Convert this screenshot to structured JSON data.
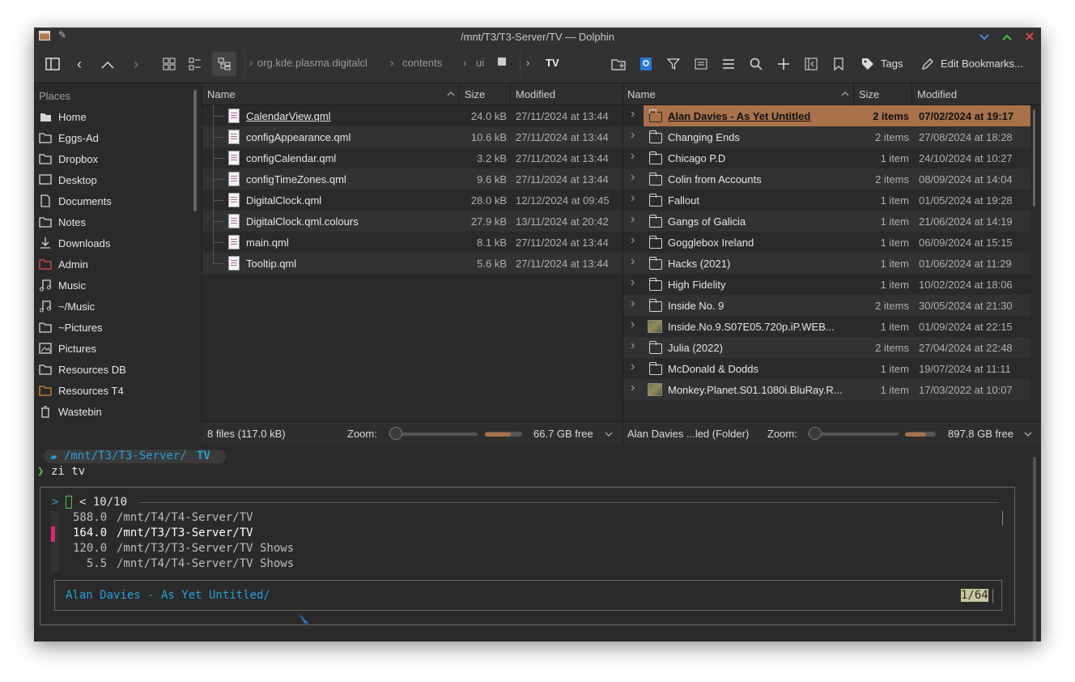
{
  "window": {
    "title": "/mnt/T3/T3-Server/TV — Dolphin",
    "min_icon": "chevron-down-icon",
    "max_icon": "chevron-up-icon",
    "close_icon": "close-icon"
  },
  "colors": {
    "accent": "#a9714a",
    "background": "#2a2a2a",
    "prompt_path": "#2a9fd6",
    "prompt_arrow": "#4ec94e",
    "close": "#e04848",
    "maximize": "#49c149",
    "minimize": "#4a8ad4",
    "marker": "#e0247c"
  },
  "toolbar": {
    "breadcrumbs": [
      "org.kde.plasma.digitalcl",
      "contents",
      "ui"
    ],
    "current": "TV",
    "tags_label": "Tags",
    "bookmarks_label": "Edit Bookmarks..."
  },
  "places": {
    "title": "Places",
    "items": [
      {
        "label": "Home",
        "icon": "home-icon"
      },
      {
        "label": "Eggs-Ad",
        "icon": "folder-icon"
      },
      {
        "label": "Dropbox",
        "icon": "folder-icon"
      },
      {
        "label": "Desktop",
        "icon": "desktop-icon"
      },
      {
        "label": "Documents",
        "icon": "documents-icon"
      },
      {
        "label": "Notes",
        "icon": "folder-icon"
      },
      {
        "label": "Downloads",
        "icon": "download-icon"
      },
      {
        "label": "Admin",
        "icon": "folder-red-icon"
      },
      {
        "label": "Music",
        "icon": "music-icon"
      },
      {
        "label": "~/Music",
        "icon": "music-icon"
      },
      {
        "label": "~Pictures",
        "icon": "folder-icon"
      },
      {
        "label": "Pictures",
        "icon": "pictures-icon"
      },
      {
        "label": "Resources DB",
        "icon": "folder-icon"
      },
      {
        "label": "Resources T4",
        "icon": "folder-orange-icon"
      },
      {
        "label": "Wastebin",
        "icon": "trash-icon"
      }
    ]
  },
  "left_pane": {
    "headers": {
      "name": "Name",
      "size": "Size",
      "modified": "Modified"
    },
    "files": [
      {
        "name": "CalendarView.qml",
        "size": "24.0 kB",
        "modified": "27/11/2024 at 13:44"
      },
      {
        "name": "configAppearance.qml",
        "size": "10.6 kB",
        "modified": "27/11/2024 at 13:44"
      },
      {
        "name": "configCalendar.qml",
        "size": "3.2 kB",
        "modified": "27/11/2024 at 13:44"
      },
      {
        "name": "configTimeZones.qml",
        "size": "9.6 kB",
        "modified": "27/11/2024 at 13:44"
      },
      {
        "name": "DigitalClock.qml",
        "size": "28.0 kB",
        "modified": "12/12/2024 at 09:45"
      },
      {
        "name": "DigitalClock.qml.colours",
        "size": "27.9 kB",
        "modified": "13/11/2024 at 20:42"
      },
      {
        "name": "main.qml",
        "size": "8.1 kB",
        "modified": "27/11/2024 at 13:44"
      },
      {
        "name": "Tooltip.qml",
        "size": "5.6 kB",
        "modified": "27/11/2024 at 13:44"
      }
    ],
    "status": "8 files (117.0 kB)",
    "zoom_label": "Zoom:",
    "free": "66.7 GB free"
  },
  "right_pane": {
    "headers": {
      "name": "Name",
      "size": "Size",
      "modified": "Modified"
    },
    "items": [
      {
        "name": "Alan Davies - As Yet Untitled",
        "size": "2 items",
        "modified": "07/02/2024 at 19:17",
        "type": "folder",
        "selected": true
      },
      {
        "name": "Changing Ends",
        "size": "2 items",
        "modified": "27/08/2024 at 18:28",
        "type": "folder"
      },
      {
        "name": "Chicago P.D",
        "size": "1 item",
        "modified": "24/10/2024 at 10:27",
        "type": "folder"
      },
      {
        "name": "Colin from Accounts",
        "size": "2 items",
        "modified": "08/09/2024 at 14:04",
        "type": "folder"
      },
      {
        "name": "Fallout",
        "size": "1 item",
        "modified": "01/05/2024 at 19:28",
        "type": "folder"
      },
      {
        "name": "Gangs of Galicia",
        "size": "1 item",
        "modified": "21/06/2024 at 14:19",
        "type": "folder"
      },
      {
        "name": "Gogglebox Ireland",
        "size": "1 item",
        "modified": "06/09/2024 at 15:15",
        "type": "folder"
      },
      {
        "name": "Hacks (2021)",
        "size": "1 item",
        "modified": "01/06/2024 at 11:29",
        "type": "folder"
      },
      {
        "name": "High Fidelity",
        "size": "1 item",
        "modified": "10/02/2024 at 18:06",
        "type": "folder"
      },
      {
        "name": "Inside No. 9",
        "size": "2 items",
        "modified": "30/05/2024 at 21:30",
        "type": "folder"
      },
      {
        "name": "Inside.No.9.S07E05.720p.iP.WEB...",
        "size": "1 item",
        "modified": "01/09/2024 at 22:15",
        "type": "thumb"
      },
      {
        "name": "Julia (2022)",
        "size": "2 items",
        "modified": "27/04/2024 at 22:48",
        "type": "folder"
      },
      {
        "name": "McDonald & Dodds",
        "size": "1 item",
        "modified": "19/07/2024 at 11:11",
        "type": "folder"
      },
      {
        "name": "Monkey.Planet.S01.1080i.BluRay.R...",
        "size": "1 item",
        "modified": "17/03/2022 at 10:07",
        "type": "thumb"
      }
    ],
    "status": "Alan Davies ...led (Folder)",
    "zoom_label": "Zoom:",
    "free": "897.8 GB free"
  },
  "terminal": {
    "path_prefix": "/mnt/T3/T3-Server/",
    "path_last": "TV",
    "prompt_arrow": "❯",
    "command": "zi tv",
    "fzf_prompt": ">",
    "fzf_count": "< 10/10",
    "results": [
      {
        "score": "588.0",
        "path": "/mnt/T4/T4-Server/TV"
      },
      {
        "score": "164.0",
        "path": "/mnt/T3/T3-Server/TV"
      },
      {
        "score": "120.0",
        "path": "/mnt/T3/T3-Server/TV Shows"
      },
      {
        "score": "  5.5",
        "path": "/mnt/T4/T4-Server/TV Shows"
      }
    ],
    "preview_text": "Alan Davies - As Yet Untitled/",
    "preview_counter": "1/64"
  }
}
